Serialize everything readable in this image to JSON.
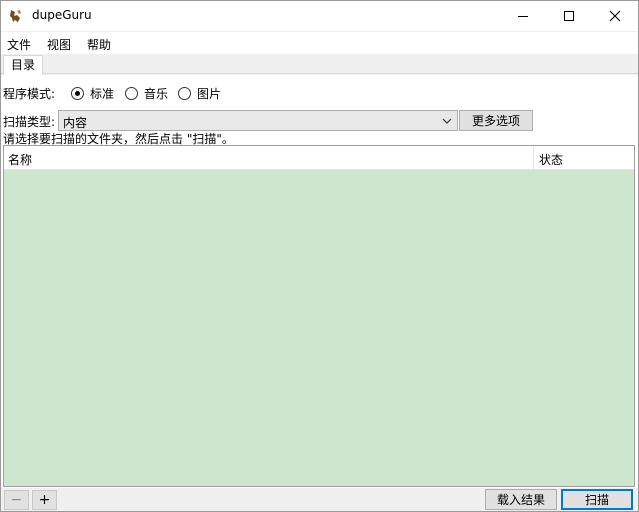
{
  "window": {
    "title": "dupeGuru"
  },
  "menu": {
    "file": "文件",
    "view": "视图",
    "help": "帮助"
  },
  "tabs": [
    {
      "label": "目录",
      "selected": true
    }
  ],
  "mode": {
    "label": "程序模式:",
    "options": [
      {
        "label": "标准",
        "checked": true
      },
      {
        "label": "音乐",
        "checked": false
      },
      {
        "label": "图片",
        "checked": false
      }
    ]
  },
  "scan": {
    "label": "扫描类型:",
    "selected": "内容",
    "more_options": "更多选项"
  },
  "hint": "请选择要扫描的文件夹，然后点击 \"扫描\"。",
  "folders": {
    "columns": {
      "name": "名称",
      "state": "状态"
    },
    "rows": []
  },
  "bottom": {
    "remove": "−",
    "add": "+",
    "load_results": "载入结果",
    "scan": "扫描"
  },
  "colors": {
    "list_background": "#cde6cd",
    "focus_border": "#0078d7"
  }
}
